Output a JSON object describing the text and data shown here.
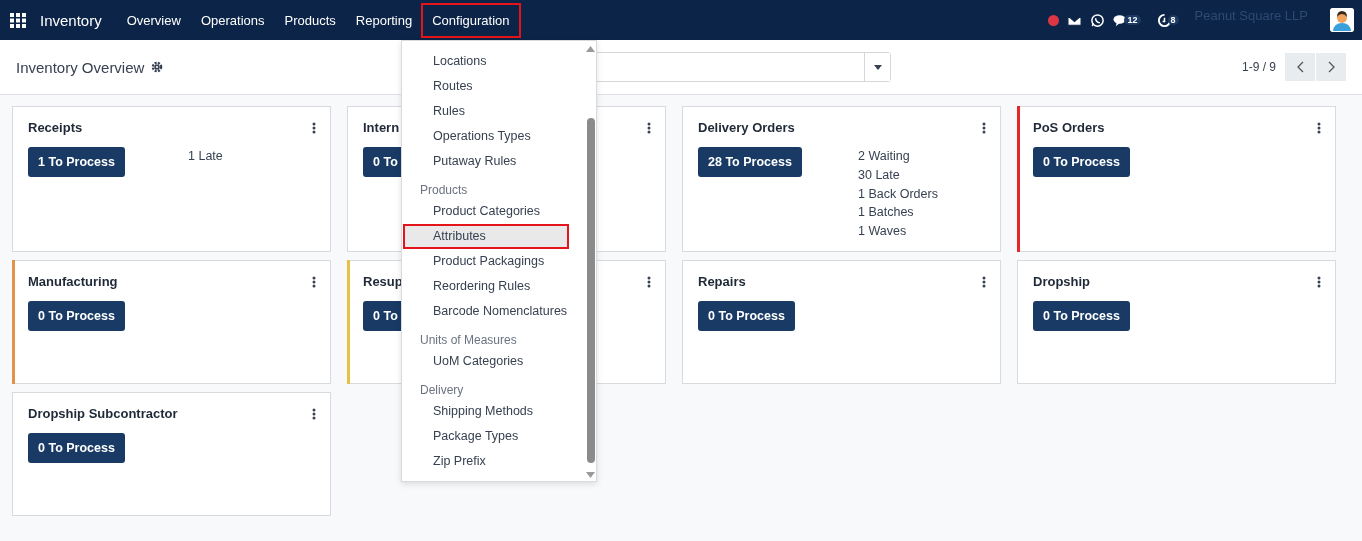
{
  "navbar": {
    "app": "Inventory",
    "menus": [
      {
        "label": "Overview",
        "selected": false
      },
      {
        "label": "Operations",
        "selected": false
      },
      {
        "label": "Products",
        "selected": false
      },
      {
        "label": "Reporting",
        "selected": false
      },
      {
        "label": "Configuration",
        "selected": true
      }
    ],
    "messages_count": "12",
    "activities_count": "8",
    "company": "Peanut Square LLP"
  },
  "control_panel": {
    "title": "Inventory Overview",
    "pager": "1-9 / 9"
  },
  "cards": [
    {
      "title": "Receipts",
      "button": "1 To Process",
      "stats": [
        "1 Late"
      ]
    },
    {
      "title": "Intern",
      "button": "0 To"
    },
    {
      "title": "Delivery Orders",
      "button": "28 To Process",
      "stats": [
        "2 Waiting",
        "30 Late",
        "1 Back Orders",
        "1 Batches",
        "1 Waves"
      ]
    },
    {
      "title": "PoS Orders",
      "button": "0 To Process",
      "color": "#e5262b"
    },
    {
      "title": "Manufacturing",
      "button": "0 To Process",
      "color": "#e0944a"
    },
    {
      "title": "Resup",
      "button": "0 To",
      "color": "#e9c046"
    },
    {
      "title": "Repairs",
      "button": "0 To Process"
    },
    {
      "title": "Dropship",
      "button": "0 To Process"
    },
    {
      "title": "Dropship Subcontractor",
      "button": "0 To Process"
    }
  ],
  "dropdown": {
    "groups": [
      {
        "items": [
          {
            "label": "Locations",
            "selected": false
          },
          {
            "label": "Routes",
            "selected": false
          },
          {
            "label": "Rules",
            "selected": false
          },
          {
            "label": "Operations Types",
            "selected": false
          },
          {
            "label": "Putaway Rules",
            "selected": false
          }
        ]
      },
      {
        "header": "Products",
        "items": [
          {
            "label": "Product Categories",
            "selected": false
          },
          {
            "label": "Attributes",
            "selected": true
          },
          {
            "label": "Product Packagings",
            "selected": false
          },
          {
            "label": "Reordering Rules",
            "selected": false
          },
          {
            "label": "Barcode Nomenclatures",
            "selected": false
          }
        ]
      },
      {
        "header": "Units of Measures",
        "items": [
          {
            "label": "UoM Categories",
            "selected": false
          }
        ]
      },
      {
        "header": "Delivery",
        "items": [
          {
            "label": "Shipping Methods",
            "selected": false
          },
          {
            "label": "Package Types",
            "selected": false
          },
          {
            "label": "Zip Prefix",
            "selected": false
          }
        ]
      }
    ]
  }
}
